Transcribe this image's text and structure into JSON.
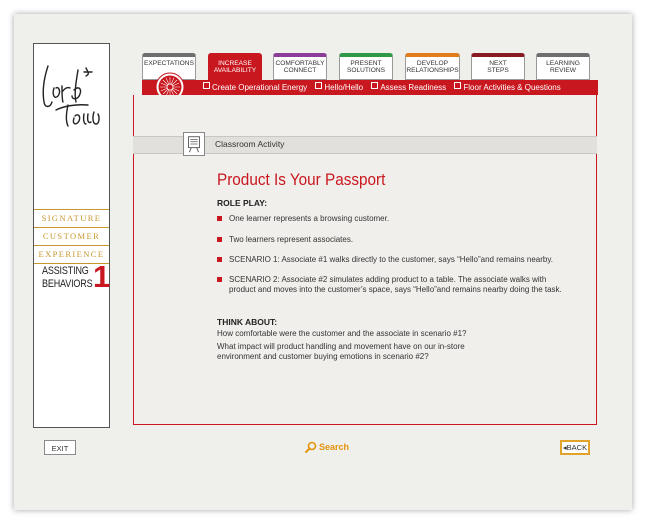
{
  "sidebar": {
    "brand_lines": [
      "SIGNATURE",
      "CUSTOMER",
      "EXPERIENCE"
    ],
    "module_title_1": "ASSISTING",
    "module_title_2": "BEHAVIORS",
    "module_number": "1"
  },
  "tabs": [
    {
      "label1": "EXPECTATIONS",
      "label2": "",
      "color": "#6e6e6e",
      "active": false
    },
    {
      "label1": "INCREASE",
      "label2": "AVAILABILITY",
      "color": "#c8171e",
      "active": true
    },
    {
      "label1": "COMFORTABLY",
      "label2": "CONNECT",
      "color": "#8c3d9a",
      "active": false
    },
    {
      "label1": "PRESENT",
      "label2": "SOLUTIONS",
      "color": "#2e9a46",
      "active": false
    },
    {
      "label1": "DEVELOP",
      "label2": "RELATIONSHIPS",
      "color": "#e37c1a",
      "active": false
    },
    {
      "label1": "NEXT",
      "label2": "STEPS",
      "color": "#8a1a22",
      "active": false
    },
    {
      "label1": "LEARNING",
      "label2": "REVIEW",
      "color": "#6e6e6e",
      "active": false
    }
  ],
  "subnav": [
    "Create Operational Energy",
    "Hello/Hello",
    "Assess Readiness",
    "Floor Activities & Questions"
  ],
  "activity": {
    "label": "Classroom Activity"
  },
  "content": {
    "title": "Product Is Your Passport",
    "role_play_heading": "ROLE PLAY:",
    "bullets": [
      "One learner represents a browsing customer.",
      "Two learners represent associates.",
      "SCENARIO 1: Associate #1 walks directly to the customer, says “Hello”and remains nearby.",
      "SCENARIO 2: Associate #2 simulates adding product to a table. The associate walks with product and moves into the customer’s space, says “Hello”and remains nearby doing the task."
    ],
    "think_heading": "THINK ABOUT:",
    "think_q1": "How comfortable were the customer and the associate in scenario #1?",
    "think_q2": "What impact will product handling and movement have on our in-store environment and customer buying emotions in scenario #2?"
  },
  "footer": {
    "exit_label": "EXIT",
    "search_label": "Search",
    "back_label": "◂BACK"
  },
  "colors": {
    "accent_red": "#c8171e",
    "gold": "#c8962e",
    "orange": "#e3930c"
  }
}
